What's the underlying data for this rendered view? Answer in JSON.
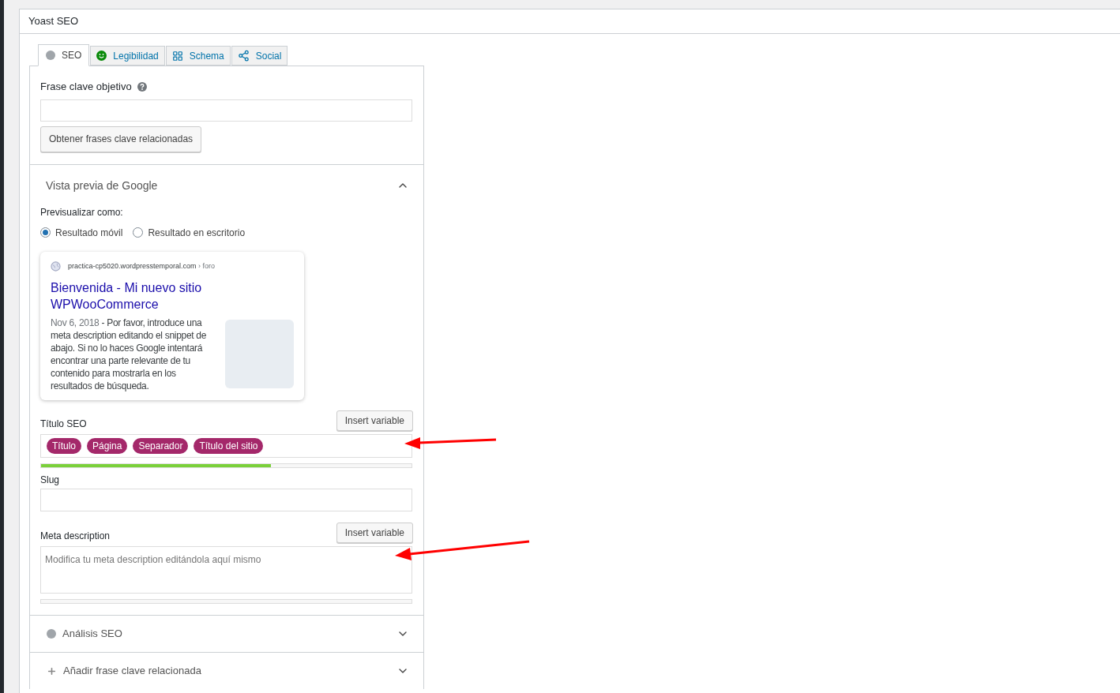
{
  "panel": {
    "title": "Yoast SEO"
  },
  "tabs": [
    {
      "kind": "dot",
      "label": "SEO",
      "selected": true
    },
    {
      "kind": "smiley",
      "label": "Legibilidad",
      "selected": false
    },
    {
      "kind": "grid",
      "label": "Schema",
      "selected": false
    },
    {
      "kind": "share",
      "label": "Social",
      "selected": false
    }
  ],
  "focus_keyphrase": {
    "label": "Frase clave objetivo",
    "button": "Obtener frases clave relacionadas"
  },
  "google_preview": {
    "title": "Vista previa de Google",
    "expanded": true,
    "preview_as": "Previsualizar como:",
    "modes": [
      {
        "label": "Resultado móvil",
        "selected": true
      },
      {
        "label": "Resultado en escritorio",
        "selected": false
      }
    ],
    "snippet": {
      "url": "practica-cp5020.wordpresstemporal.com",
      "breadcrumb": "› foro",
      "title": "Bienvenida - Mi nuevo sitio WPWooCommerce",
      "date": "Nov 6, 2018",
      "separator": "-",
      "description": "Por favor, introduce una meta description editando el snippet de abajo. Si no lo haces Google intentará encontrar una parte relevante de tu contenido para mostrarla en los resultados de búsqueda."
    }
  },
  "seo_title": {
    "label": "Título SEO",
    "button": "Insert variable",
    "tags": [
      "Título",
      "Página",
      "Separador",
      "Título del sitio"
    ],
    "level": 0.62
  },
  "slug": {
    "label": "Slug"
  },
  "meta_description": {
    "label": "Meta description",
    "button": "Insert variable",
    "placeholder": "Modifica tu meta description editándola aquí mismo",
    "level": 0
  },
  "sections": [
    {
      "kind": "dot",
      "label": "Análisis SEO",
      "expanded": false
    },
    {
      "kind": "plus",
      "label": "Añadir frase clave relacionada",
      "expanded": false
    }
  ]
}
